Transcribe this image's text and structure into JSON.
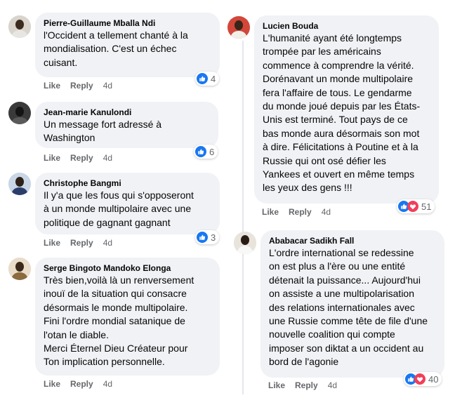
{
  "actions": {
    "like_label": "Like",
    "reply_label": "Reply"
  },
  "colors": {
    "bubble": "#f0f2f5",
    "like_blue": "#1877f2",
    "love_red": "#f33e58",
    "meta_text": "#65676b"
  },
  "comments": [
    {
      "author": "Pierre-Guillaume Mballa Ndi",
      "text": "l'Occident a tellement chanté à la\nmondialisation. C'est un échec\ncuisant.",
      "time": "4d",
      "reaction_count": "4",
      "reaction_icons": [
        "like-icon"
      ]
    },
    {
      "author": "Jean-marie Kanulondi",
      "text": "Un message fort adressé à\nWashington",
      "time": "4d",
      "reaction_count": "6",
      "reaction_icons": [
        "like-icon"
      ]
    },
    {
      "author": "Christophe Bangmi",
      "text": "Il y'a que les fous qui s'opposeront\nà un monde multipolaire avec une\npolitique de gagnant gagnant",
      "time": "4d",
      "reaction_count": "3",
      "reaction_icons": [
        "like-icon"
      ]
    },
    {
      "author": "Serge Bingoto Mandoko Elonga",
      "text": "Très bien,voilà là un renversement\ninouï de la situation qui consacre\ndésormais le monde multipolaire.\nFini l'ordre mondial satanique de\nl'otan le diable.\nMerci Éternel Dieu Créateur pour\nTon implication personnelle.",
      "time": "4d"
    },
    {
      "author": "Lucien Bouda",
      "text": "L'humanité ayant été longtemps\ntrompée par les américains\ncommence à comprendre la vérité.\nDorénavant un monde multipolaire\nfera l'affaire de tous. Le gendarme\ndu monde joué depuis par les États-\nUnis est terminé. Tout pays de ce\nbas monde aura désormais son mot\nà dire. Félicitations à Poutine et à la\nRussie qui ont osé défier les\nYankees et ouvert en même temps\nles yeux des gens !!!",
      "time": "4d",
      "reaction_count": "51",
      "reaction_icons": [
        "like-icon",
        "love-icon"
      ]
    },
    {
      "author": "Ababacar Sadikh Fall",
      "text": "L'ordre international se redessine\non est plus a l'ère ou une entité\ndétenait la puissance... Aujourd'hui\non assiste a une multipolarisation\ndes relations internationales avec\nune Russie comme tête de file d'une\nnouvelle coalition qui compte\nimposer son diktat a un occident au\nbord de l'agonie",
      "time": "4d",
      "reaction_count": "40",
      "reaction_icons": [
        "like-icon",
        "love-icon"
      ]
    }
  ]
}
